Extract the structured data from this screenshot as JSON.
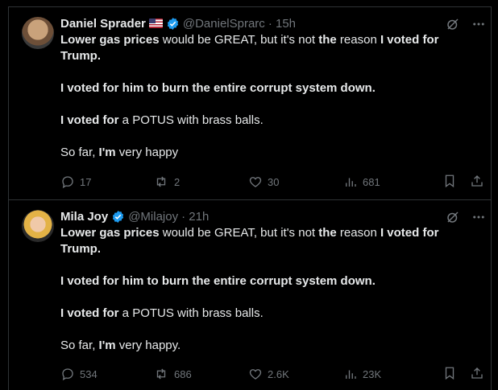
{
  "posts": [
    {
      "name": "Daniel Sprader",
      "handle": "@DanielSprarc",
      "time": "· 15h",
      "lines": [
        [
          [
            "b",
            "Lower gas prices"
          ],
          [
            "n",
            " would be GREAT, but it's not "
          ],
          [
            "b",
            "the"
          ],
          [
            "n",
            " reason "
          ],
          [
            "b",
            "I voted for Trump."
          ]
        ],
        [],
        [
          [
            "b",
            "I voted for him to burn the entire corrupt system down."
          ]
        ],
        [],
        [
          [
            "b",
            "I voted for"
          ],
          [
            "n",
            " a POTUS with brass balls."
          ]
        ],
        [],
        [
          [
            "n",
            "So far, "
          ],
          [
            "b",
            "I'm"
          ],
          [
            "n",
            " very happy"
          ]
        ]
      ],
      "replies": "17",
      "reposts": "2",
      "likes": "30",
      "views": "681"
    },
    {
      "name": "Mila Joy",
      "handle": "@Milajoy",
      "time": "· 21h",
      "lines": [
        [
          [
            "b",
            "Lower gas prices"
          ],
          [
            "n",
            " would be GREAT, but it's not "
          ],
          [
            "b",
            "the"
          ],
          [
            "n",
            " reason "
          ],
          [
            "b",
            "I voted for Trump."
          ]
        ],
        [],
        [
          [
            "b",
            "I voted for him to burn the entire corrupt system down."
          ]
        ],
        [],
        [
          [
            "b",
            "I voted for"
          ],
          [
            "n",
            " a POTUS with brass balls."
          ]
        ],
        [],
        [
          [
            "n",
            "So far, "
          ],
          [
            "b",
            "I'm"
          ],
          [
            "n",
            " very happy."
          ]
        ]
      ],
      "replies": "534",
      "reposts": "686",
      "likes": "2.6K",
      "views": "23K"
    }
  ],
  "colors": {
    "accent": "#1d9bf0",
    "muted": "#71767b",
    "text": "#e7e9ea",
    "divider": "#2f3336"
  },
  "icons": [
    "grok-icon",
    "more-icon",
    "reply-icon",
    "repost-icon",
    "like-icon",
    "views-icon",
    "bookmark-icon",
    "share-icon",
    "verified-icon",
    "us-flag-icon"
  ]
}
